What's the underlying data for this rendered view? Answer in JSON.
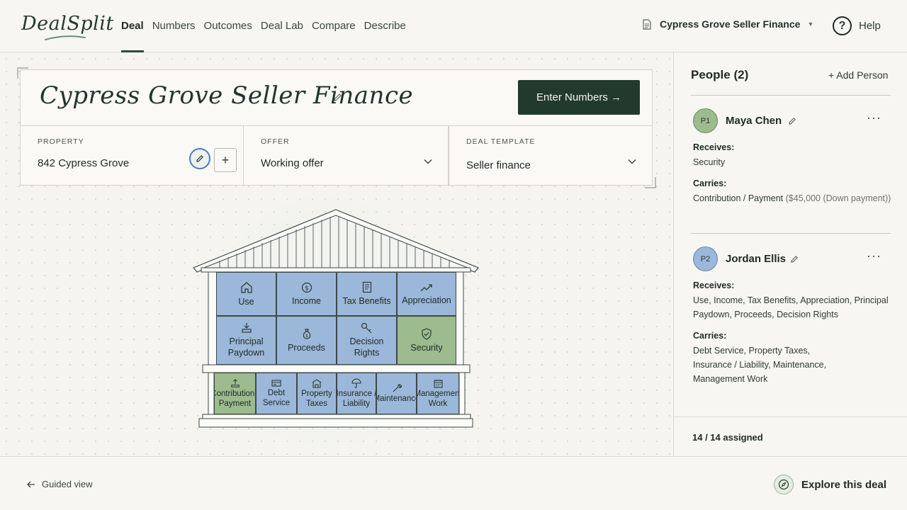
{
  "app": {
    "logo": "DealSplit",
    "nav_tabs": [
      "Deal",
      "Numbers",
      "Outcomes",
      "Deal Lab",
      "Compare",
      "Describe"
    ],
    "active_tab": "Deal",
    "document": "Cypress Grove Seller Finance",
    "help": "Help"
  },
  "deal": {
    "title": "Cypress Grove Seller Finance",
    "enter_button": "Enter Numbers →",
    "property_label": "PROPERTY",
    "property_value": "842 Cypress Grove",
    "offer_label": "OFFER",
    "offer_value": "Working offer",
    "template_label": "DEAL TEMPLATE",
    "template_value": "Seller finance"
  },
  "house": {
    "cells": [
      {
        "label": "Use",
        "icon": "house-icon",
        "color": "blue"
      },
      {
        "label": "Income",
        "icon": "dollar-circle-icon",
        "color": "blue"
      },
      {
        "label": "Tax Benefits",
        "icon": "receipt-icon",
        "color": "blue"
      },
      {
        "label": "Appreciation",
        "icon": "trend-up-icon",
        "color": "blue"
      },
      {
        "label": "Principal Paydown",
        "icon": "download-tray-icon",
        "color": "blue"
      },
      {
        "label": "Proceeds",
        "icon": "money-bag-icon",
        "color": "blue"
      },
      {
        "label": "Decision Rights",
        "icon": "key-icon",
        "color": "blue"
      },
      {
        "label": "Security",
        "icon": "shield-check-icon",
        "color": "green"
      },
      {
        "label": "Contribution / Payment",
        "icon": "upload-tray-icon",
        "color": "green"
      },
      {
        "label": "Debt Service",
        "icon": "card-icon",
        "color": "blue"
      },
      {
        "label": "Property Taxes",
        "icon": "building-icon",
        "color": "blue"
      },
      {
        "label": "Insurance / Liability",
        "icon": "umbrella-icon",
        "color": "blue"
      },
      {
        "label": "Maintenance",
        "icon": "wrench-icon",
        "color": "blue"
      },
      {
        "label": "Management Work",
        "icon": "calendar-icon",
        "color": "blue"
      }
    ],
    "colors": {
      "blue": "#9bb7d9",
      "green": "#9cbb8f"
    }
  },
  "people": {
    "title": "People (2)",
    "add_label": "+ Add Person",
    "list": [
      {
        "initials": "P1",
        "name": "Maya Chen",
        "receives_label": "Receives:",
        "receives": "Security",
        "carries_label": "Carries:",
        "carries": "Contribution / Payment",
        "carries_note": "($45,000 (Down payment))"
      },
      {
        "initials": "P2",
        "name": "Jordan Ellis",
        "receives_label": "Receives:",
        "receives": "Use, Income, Tax Benefits, Appreciation, Principal Paydown, Proceeds, Decision Rights",
        "carries_label": "Carries:",
        "carries": "Debt Service, Property Taxes, Insurance / Liability, Maintenance, Management Work"
      }
    ],
    "assigned": "14 / 14 assigned"
  },
  "footer": {
    "guided": "Guided view",
    "explore": "Explore this deal"
  }
}
